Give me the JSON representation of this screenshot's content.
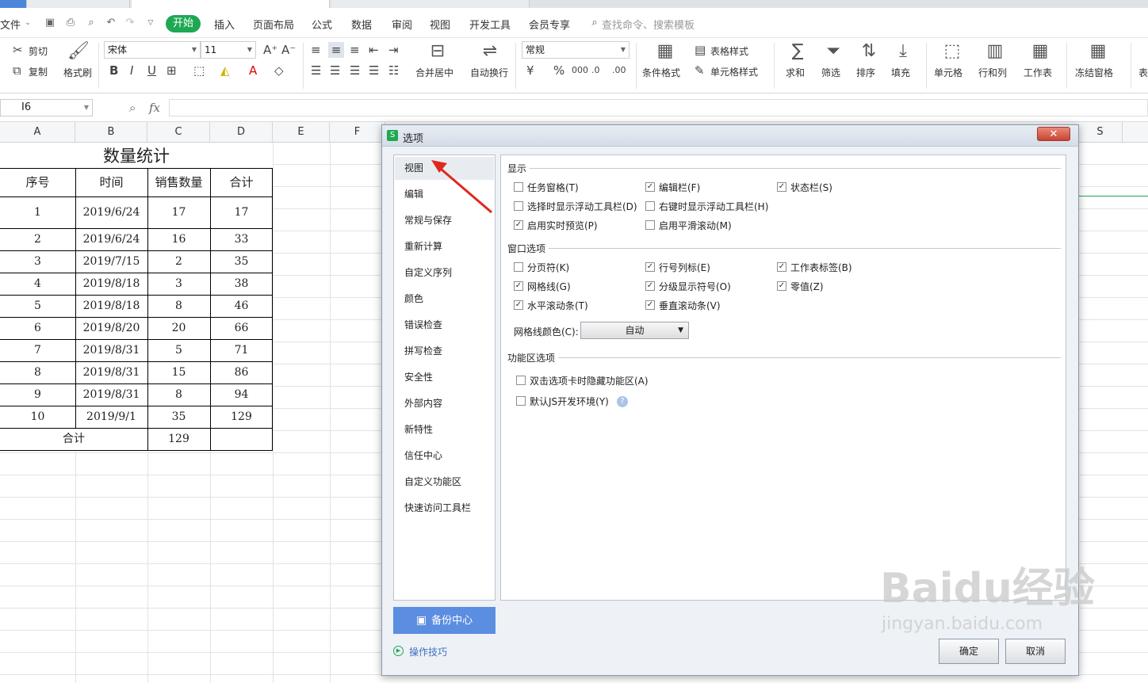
{
  "menu": {
    "file": "文件",
    "start": "开始",
    "items": [
      "插入",
      "页面布局",
      "公式",
      "数据",
      "审阅",
      "视图",
      "开发工具",
      "会员专享"
    ],
    "search_placeholder": "查找命令、搜索模板"
  },
  "ribbon": {
    "cut": "剪切",
    "copy": "复制",
    "format_painter": "格式刷",
    "font_name": "宋体",
    "font_size": "11",
    "merge_center": "合并居中",
    "wrap_text": "自动换行",
    "number_format": "常规",
    "conditional_format": "条件格式",
    "table_style": "表格样式",
    "cell_style": "单元格样式",
    "sum": "求和",
    "filter": "筛选",
    "sort": "排序",
    "fill": "填充",
    "cells": "单元格",
    "rows_cols": "行和列",
    "worksheet": "工作表",
    "freeze": "冻结窗格",
    "more": "表"
  },
  "formula_bar": {
    "name_box": "I6",
    "fx": "fx"
  },
  "columns": [
    "A",
    "B",
    "C",
    "D",
    "E",
    "F",
    "S"
  ],
  "sheet": {
    "title": "数量统计",
    "headers": [
      "序号",
      "时间",
      "销售数量",
      "合计"
    ],
    "rows": [
      [
        "1",
        "2019/6/24",
        "17",
        "17"
      ],
      [
        "2",
        "2019/6/24",
        "16",
        "33"
      ],
      [
        "3",
        "2019/7/15",
        "2",
        "35"
      ],
      [
        "4",
        "2019/8/18",
        "3",
        "38"
      ],
      [
        "5",
        "2019/8/18",
        "8",
        "46"
      ],
      [
        "6",
        "2019/8/20",
        "20",
        "66"
      ],
      [
        "7",
        "2019/8/31",
        "5",
        "71"
      ],
      [
        "8",
        "2019/8/31",
        "15",
        "86"
      ],
      [
        "9",
        "2019/8/31",
        "8",
        "94"
      ],
      [
        "10",
        "2019/9/1",
        "35",
        "129"
      ]
    ],
    "total_label": "合计",
    "total_value": "129"
  },
  "dialog": {
    "title": "选项",
    "close": "✕",
    "nav": [
      "视图",
      "编辑",
      "常规与保存",
      "重新计算",
      "自定义序列",
      "颜色",
      "错误检查",
      "拼写检查",
      "安全性",
      "外部内容",
      "新特性",
      "信任中心",
      "自定义功能区",
      "快速访问工具栏"
    ],
    "section_display": "显示",
    "display_options": [
      {
        "label": "任务窗格(T)",
        "checked": false
      },
      {
        "label": "编辑栏(F)",
        "checked": true
      },
      {
        "label": "状态栏(S)",
        "checked": true
      },
      {
        "label": "选择时显示浮动工具栏(D)",
        "checked": false
      },
      {
        "label": "右键时显示浮动工具栏(H)",
        "checked": false
      },
      {
        "label": "启用实时预览(P)",
        "checked": true
      },
      {
        "label": "启用平滑滚动(M)",
        "checked": false
      }
    ],
    "section_window": "窗口选项",
    "window_options": [
      {
        "label": "分页符(K)",
        "checked": false
      },
      {
        "label": "行号列标(E)",
        "checked": true
      },
      {
        "label": "工作表标签(B)",
        "checked": true
      },
      {
        "label": "网格线(G)",
        "checked": true
      },
      {
        "label": "分级显示符号(O)",
        "checked": true
      },
      {
        "label": "零值(Z)",
        "checked": true
      },
      {
        "label": "水平滚动条(T)",
        "checked": true
      },
      {
        "label": "垂直滚动条(V)",
        "checked": true
      }
    ],
    "gridline_color_label": "网格线颜色(C):",
    "gridline_color_value": "自动",
    "section_ribbon": "功能区选项",
    "ribbon_options": [
      {
        "label": "双击选项卡时隐藏功能区(A)",
        "checked": false
      },
      {
        "label": "默认JS开发环境(Y)",
        "checked": false
      }
    ],
    "backup_center": "备份中心",
    "tips": "操作技巧",
    "ok": "确定",
    "cancel": "取消"
  },
  "watermark": {
    "text": "Baidu经验",
    "url": "jingyan.baidu.com"
  }
}
